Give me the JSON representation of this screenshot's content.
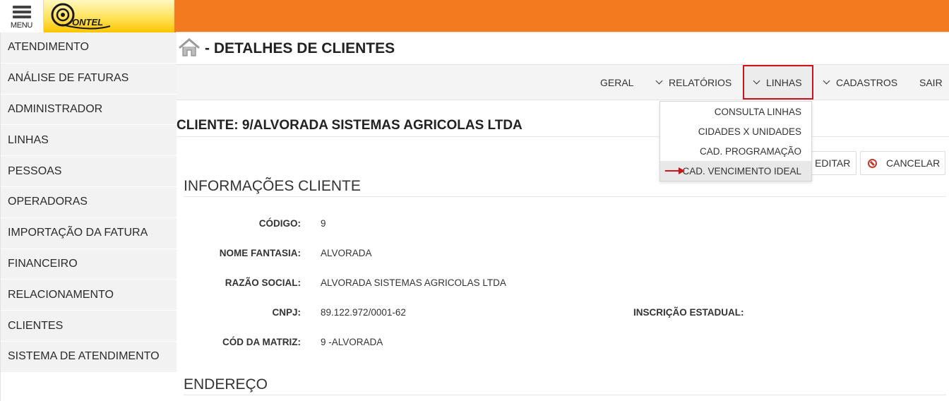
{
  "header": {
    "menu_label": "MENU",
    "logo_text": "ONTEL"
  },
  "sidebar": {
    "items": [
      {
        "label": "ATENDIMENTO"
      },
      {
        "label": "ANÁLISE DE FATURAS"
      },
      {
        "label": "ADMINISTRADOR"
      },
      {
        "label": "LINHAS"
      },
      {
        "label": "PESSOAS"
      },
      {
        "label": "OPERADORAS"
      },
      {
        "label": "IMPORTAÇÃO DA FATURA"
      },
      {
        "label": "FINANCEIRO"
      },
      {
        "label": "RELACIONAMENTO"
      },
      {
        "label": "CLIENTES"
      },
      {
        "label": "SISTEMA DE ATENDIMENTO"
      }
    ]
  },
  "page": {
    "title": "- DETALHES DE CLIENTES"
  },
  "nav": {
    "geral": "GERAL",
    "relatorios": "RELATÓRIOS",
    "linhas": "LINHAS",
    "cadastros": "CADASTROS",
    "sair": "SAIR",
    "highlight_color": "#d0131a"
  },
  "dropdown": {
    "items": [
      {
        "label": "CONSULTA LINHAS"
      },
      {
        "label": "CIDADES X UNIDADES"
      },
      {
        "label": "CAD. PROGRAMAÇÃO"
      },
      {
        "label": "CAD. VENCIMENTO IDEAL"
      }
    ]
  },
  "client": {
    "title": "CLIENTE: 9/ALVORADA SISTEMAS AGRICOLAS LTDA"
  },
  "actions": {
    "edit_label": "EDITAR",
    "cancel_label": "CANCELAR"
  },
  "info_section": {
    "heading": "INFORMAÇÕES CLIENTE",
    "fields": {
      "codigo_label": "CÓDIGO:",
      "codigo_value": "9",
      "nome_fantasia_label": "NOME FANTASIA:",
      "nome_fantasia_value": "ALVORADA",
      "razao_social_label": "RAZÃO SOCIAL:",
      "razao_social_value": "ALVORADA SISTEMAS AGRICOLAS LTDA",
      "cnpj_label": "CNPJ:",
      "cnpj_value": "89.122.972/0001-62",
      "inscricao_label": "INSCRIÇÃO ESTADUAL:",
      "inscricao_value": "",
      "matriz_label": "CÓD DA MATRIZ:",
      "matriz_value": "9 -ALVORADA"
    }
  },
  "address_section": {
    "heading": "ENDEREÇO"
  },
  "colors": {
    "topbar": "#f47a20",
    "sidebar_bg": "#f2f2f2"
  }
}
